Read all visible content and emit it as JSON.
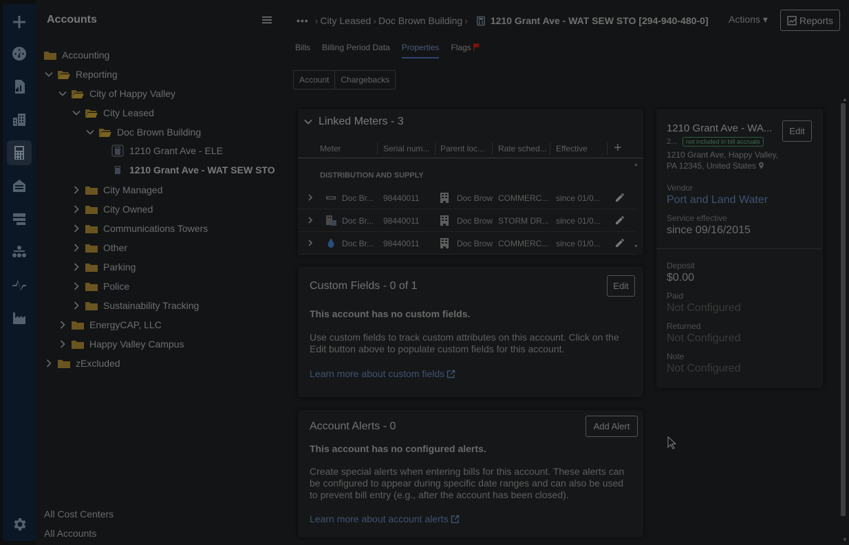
{
  "rail": {
    "items": [
      "add-icon",
      "dashboard-icon",
      "reports-icon",
      "buildings-icon",
      "accounts-icon",
      "bills-icon",
      "servers-icon",
      "hierarchy-icon",
      "activity-icon",
      "factory-icon",
      "settings-icon"
    ],
    "active": "accounts-icon"
  },
  "tree": {
    "title": "Accounts",
    "nodes": [
      {
        "label": "Accounting"
      },
      {
        "label": "Reporting"
      },
      {
        "label": "City of Happy Valley"
      },
      {
        "label": "City Leased"
      },
      {
        "label": "Doc Brown Building"
      },
      {
        "label": "1210 Grant Ave - ELE"
      },
      {
        "label": "1210 Grant Ave - WAT SEW STO"
      },
      {
        "label": "City Managed"
      },
      {
        "label": "City Owned"
      },
      {
        "label": "Communications Towers"
      },
      {
        "label": "Other"
      },
      {
        "label": "Parking"
      },
      {
        "label": "Police"
      },
      {
        "label": "Sustainability Tracking"
      },
      {
        "label": "EnergyCAP, LLC"
      },
      {
        "label": "Happy Valley Campus"
      },
      {
        "label": "zExcluded"
      }
    ],
    "footer": [
      "All Cost Centers",
      "All Accounts"
    ]
  },
  "header": {
    "more": "•••",
    "crumbs": [
      "City Leased",
      "Doc Brown Building"
    ],
    "account": "1210 Grant Ave - WAT SEW STO [294-940-480-0]",
    "actions": "Actions",
    "reports": "Reports"
  },
  "tabs": [
    "Bills",
    "Billing Period Data",
    "Properties",
    "Flags"
  ],
  "active_tab": "Properties",
  "subtabs": [
    "Account",
    "Chargebacks"
  ],
  "meters": {
    "title": "Linked Meters - 3",
    "columns": [
      "Meter",
      "Serial num...",
      "Parent loc...",
      "Rate sched...",
      "Effective"
    ],
    "group": "DISTRIBUTION AND SUPPLY",
    "rows": [
      {
        "icon": "electric-meter-icon",
        "meter": "Doc Br...",
        "serial": "98440011",
        "parent": "Doc Brow",
        "rate": "COMMERC...",
        "effective": "since 01/0..."
      },
      {
        "icon": "storm-meter-icon",
        "meter": "Doc Br...",
        "serial": "98440011",
        "parent": "Doc Brow",
        "rate": "STORM DR...",
        "effective": "since 01/0..."
      },
      {
        "icon": "water-drop-icon",
        "meter": "Doc Br...",
        "serial": "98440011",
        "parent": "Doc Brow",
        "rate": "COMMERC...",
        "effective": "since 01/0..."
      }
    ]
  },
  "info": {
    "title": "1210 Grant Ave - WA...",
    "edit": "Edit",
    "num": "2...",
    "badge": "not included in bill accruals",
    "addr1": "1210 Grant Ave, Happy Valley,",
    "addr2": "PA 12345, United States",
    "vendor_label": "Vendor",
    "vendor": "Port and Land Water",
    "service_label": "Service effective",
    "service": "since 09/16/2015",
    "deposit_label": "Deposit",
    "deposit": "$0.00",
    "paid_label": "Paid",
    "paid": "Not Configured",
    "returned_label": "Returned",
    "returned": "Not Configured",
    "note_label": "Note",
    "note": "Not Configured"
  },
  "custom": {
    "title": "Custom Fields - 0 of 1",
    "edit": "Edit",
    "empty": "This account has no custom fields.",
    "text": "Use custom fields to track custom attributes on this account. Click on the Edit button above to populate custom fields for this account.",
    "link": "Learn more about custom fields"
  },
  "alerts": {
    "title": "Account Alerts - 0",
    "add": "Add Alert",
    "empty": "This account has no configured alerts.",
    "text": "Create special alerts when entering bills for this account. These alerts can be configured to appear during specific date ranges and can also be used to prevent bill entry (e.g., after the account has been closed).",
    "link": "Learn more about account alerts"
  },
  "colors": {
    "accent": "#2e4672",
    "flag": "#8a1010",
    "badge": "#2d5d40",
    "folder": "#7a6320"
  }
}
